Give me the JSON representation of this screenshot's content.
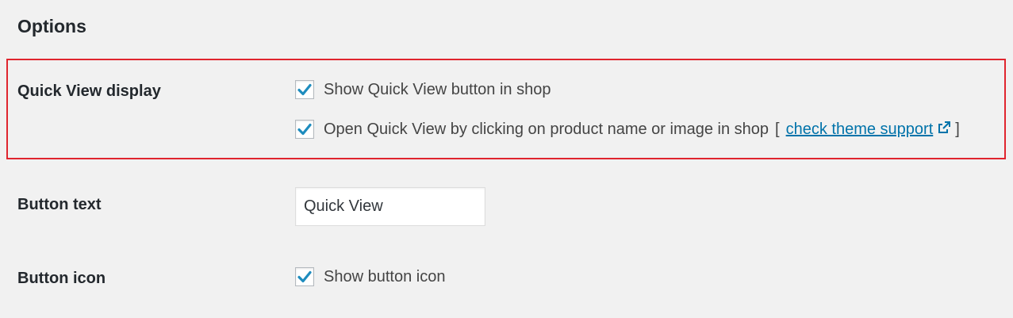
{
  "section": {
    "title": "Options"
  },
  "quick_view_display": {
    "label": "Quick View display",
    "options": [
      {
        "text": "Show Quick View button in shop",
        "checked": true
      },
      {
        "text": "Open Quick View by clicking on product name or image in shop",
        "checked": true,
        "bracket_open": "[",
        "link_text": "check theme support",
        "bracket_close": "]"
      }
    ]
  },
  "button_text": {
    "label": "Button text",
    "value": "Quick View"
  },
  "button_icon": {
    "label": "Button icon",
    "option": {
      "text": "Show button icon",
      "checked": true
    }
  },
  "colors": {
    "background": "#f1f1f1",
    "highlight": "#e0252e",
    "link": "#0073aa",
    "check": "#1e8cbe"
  },
  "icons": {
    "checkbox_mark": "checkmark-icon",
    "external_link": "external-link-icon"
  }
}
